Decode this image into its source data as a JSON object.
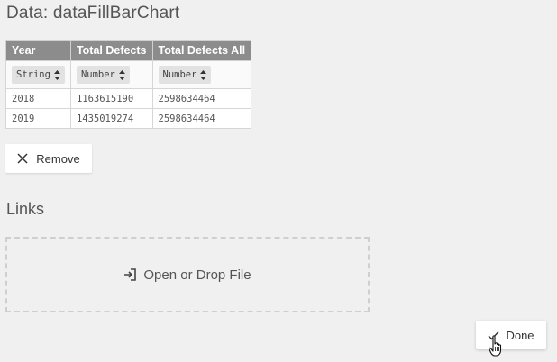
{
  "data_section": {
    "title": "Data: dataFillBarChart"
  },
  "table": {
    "columns": [
      "Year",
      "Total Defects",
      "Total Defects All"
    ],
    "types": [
      "String",
      "Number",
      "Number"
    ],
    "rows": [
      [
        "2018",
        "1163615190",
        "2598634464"
      ],
      [
        "2019",
        "1435019274",
        "2598634464"
      ]
    ]
  },
  "remove_button": {
    "label": "Remove",
    "icon": "close-icon"
  },
  "links_section": {
    "title": "Links"
  },
  "drop_zone": {
    "label": "Open or Drop File",
    "icon": "sign-in-icon"
  },
  "done_button": {
    "label": "Done",
    "icon": "checkmark-icon"
  },
  "colors": {
    "background": "#f0f0f0",
    "table_header": "#8c8c8c",
    "type_select": "#e2e2e2",
    "drop_border": "#cfcfcf"
  }
}
